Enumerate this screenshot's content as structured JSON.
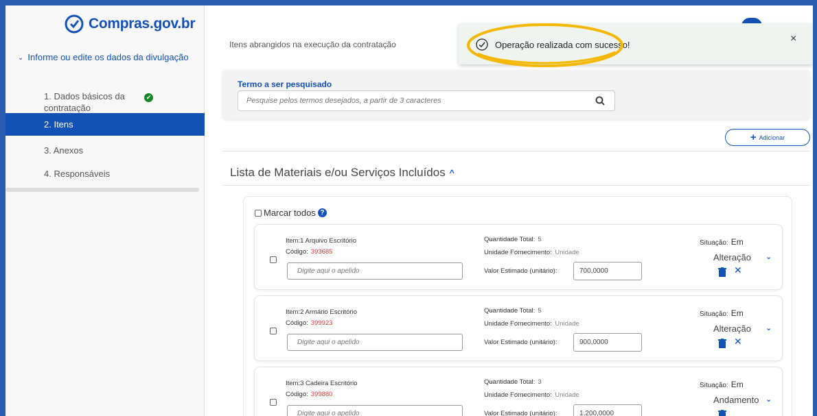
{
  "brand": {
    "name": "Compras",
    "suffix": ".gov.br"
  },
  "sidebar": {
    "section_label": "Informe ou edite os dados da divulgação",
    "items": [
      {
        "label": "1. Dados básicos da contratação",
        "completed": true
      },
      {
        "label": "2. Itens",
        "active": true
      },
      {
        "label": "3. Anexos"
      },
      {
        "label": "4. Responsáveis"
      }
    ]
  },
  "main": {
    "subtitle": "Itens abrangidos na execução da contratação",
    "search": {
      "label": "Termo a ser pesquisado",
      "placeholder": "Pesquise pelos termos desejados, a partir de 3 caracteres"
    },
    "add_button": "Adicionar",
    "list_title": "Lista de Materiais e/ou Serviços Incluídos",
    "select_all": "Marcar todos"
  },
  "items": [
    {
      "name_label": "Item:1",
      "name": "Arquivo Escritório",
      "code_label": "Código:",
      "code": "393685",
      "alias_placeholder": "Digite aqui o apelido",
      "qty_label": "Quantidade Total:",
      "qty": "5",
      "unit_label": "Unidade Fornecimento:",
      "unit": "Unidade",
      "value_label": "Valor Estimado (unitário):",
      "value": "700,0000",
      "status_label": "Situação:",
      "status_1": "Em",
      "status_2": "Alteração",
      "can_remove": true
    },
    {
      "name_label": "Item:2",
      "name": "Armário Escritório",
      "code_label": "Código:",
      "code": "399923",
      "alias_placeholder": "Digite aqui o apelido",
      "qty_label": "Quantidade Total:",
      "qty": "5",
      "unit_label": "Unidade Fornecimento:",
      "unit": "Unidade",
      "value_label": "Valor Estimado (unitário):",
      "value": "900,0000",
      "status_label": "Situação:",
      "status_1": "Em",
      "status_2": "Alteração",
      "can_remove": true
    },
    {
      "name_label": "Item:3",
      "name": "Cadeira Escritório",
      "code_label": "Código:",
      "code": "399880",
      "alias_placeholder": "Digite aqui o apelido",
      "qty_label": "Quantidade Total:",
      "qty": "3",
      "unit_label": "Unidade Fornecimento:",
      "unit": "Unidade",
      "value_label": "Valor Estimado (unitário):",
      "value": "1.200,0000",
      "status_label": "Situação:",
      "status_1": "Em",
      "status_2": "Andamento",
      "can_remove": false
    }
  ],
  "toast": {
    "message": "Operação realizada com sucesso!",
    "close": "×"
  },
  "colors": {
    "primary": "#1351b4",
    "success": "#168821",
    "highlight": "#f5b800",
    "frame": "#2a5db0"
  }
}
